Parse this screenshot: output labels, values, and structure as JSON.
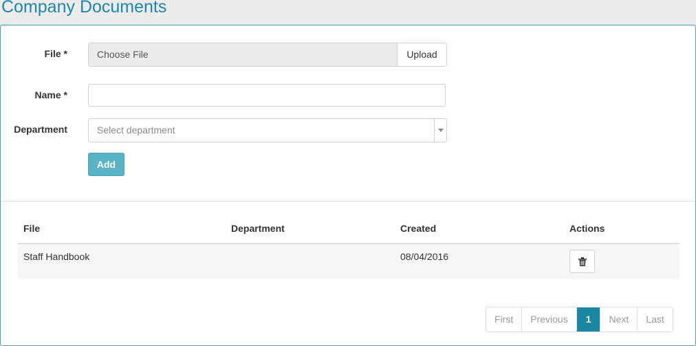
{
  "page": {
    "title": "Company Documents"
  },
  "form": {
    "file_label": "File *",
    "choose_file": "Choose File",
    "upload_label": "Upload",
    "name_label": "Name *",
    "name_value": "",
    "department_label": "Department",
    "department_placeholder": "Select department",
    "add_label": "Add"
  },
  "table": {
    "headers": [
      "File",
      "Department",
      "Created",
      "Actions"
    ],
    "rows": [
      {
        "file": "Staff Handbook",
        "department": "",
        "created": "08/04/2016"
      }
    ]
  },
  "pagination": {
    "first": "First",
    "previous": "Previous",
    "current": "1",
    "next": "Next",
    "last": "Last"
  },
  "icons": {
    "delete": "trash-icon",
    "dropdown": "caret-down-icon"
  },
  "colors": {
    "accent": "#1b87a3",
    "add_button": "#5bb4c6",
    "title": "#1e87a8"
  }
}
